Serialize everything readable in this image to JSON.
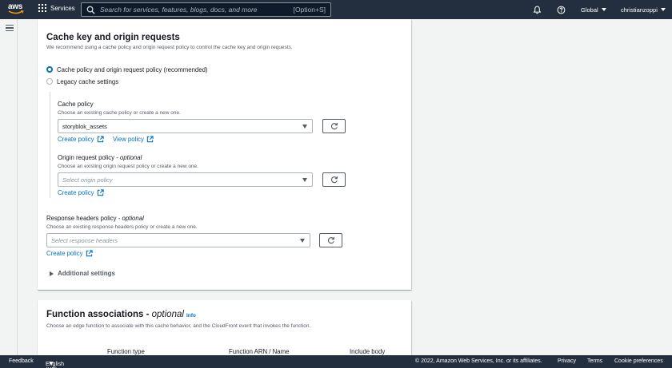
{
  "nav": {
    "logo_text": "aws",
    "services_label": "Services",
    "search_placeholder": "Search for services, features, blogs, docs, and more",
    "search_shortcut": "[Option+S]",
    "region": "Global",
    "user": "christianzoppi"
  },
  "cache_section": {
    "title": "Cache key and origin requests",
    "description": "We recommend using a cache policy and origin request policy to control the cache key and origin requests.",
    "radio_recommended": "Cache policy and origin request policy (recommended)",
    "radio_legacy": "Legacy cache settings",
    "cache_policy": {
      "label": "Cache policy",
      "description": "Choose an existing cache policy or create a new one.",
      "value": "storyblok_assets",
      "create_link": "Create policy",
      "view_link": "View policy"
    },
    "origin_request_policy": {
      "label": "Origin request policy - ",
      "optional": "optional",
      "description": "Choose an existing origin request policy or create a new one.",
      "placeholder": "Select origin policy",
      "create_link": "Create policy"
    },
    "response_headers_policy": {
      "label": "Response headers policy - ",
      "optional": "optional",
      "description": "Choose an existing response headers policy or create a new one.",
      "placeholder": "Select response headers",
      "create_link": "Create policy"
    },
    "additional_settings": "Additional settings"
  },
  "function_section": {
    "title": "Function associations - ",
    "optional": "optional",
    "info": "Info",
    "description": "Choose an edge function to associate with this cache behavior, and the CloudFront event that invokes the function.",
    "columns": [
      "Function type",
      "Function ARN / Name",
      "Include body"
    ]
  },
  "footer": {
    "feedback": "Feedback",
    "language": "English (US)",
    "copyright": "© 2022, Amazon Web Services, Inc. or its affiliates.",
    "privacy": "Privacy",
    "terms": "Terms",
    "cookie": "Cookie preferences"
  },
  "colors": {
    "nav_bg": "#232f3e",
    "link": "#0073bb",
    "page_bg": "#f2f3f3"
  }
}
